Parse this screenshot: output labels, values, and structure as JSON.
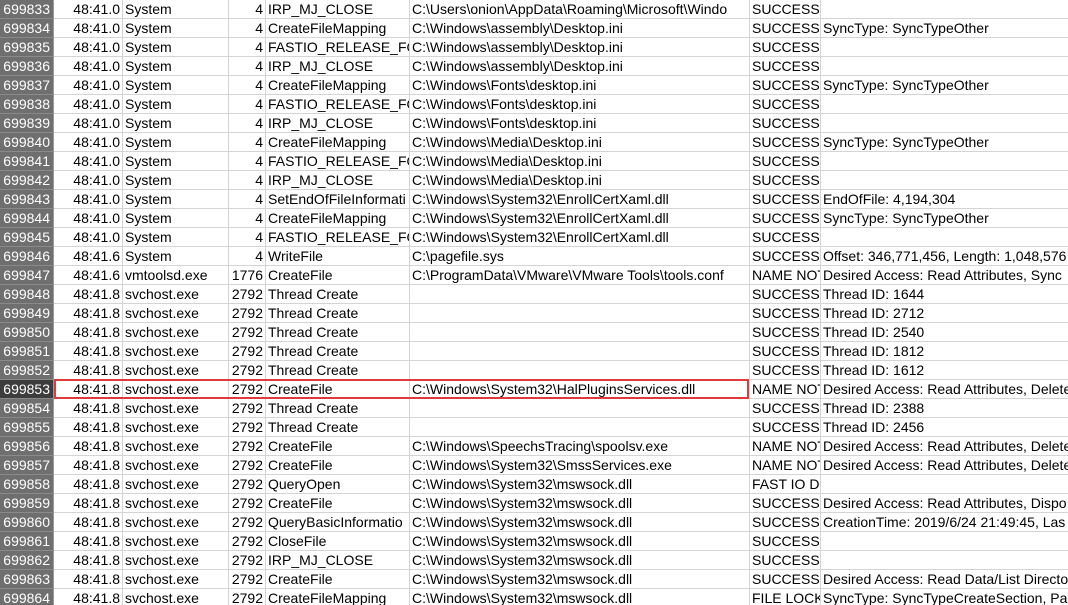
{
  "table": {
    "highlight_color": "#e23a3a",
    "rows": [
      {
        "id": "699833",
        "time": "48:41.0",
        "process": "System",
        "pid": "4",
        "operation": "IRP_MJ_CLOSE",
        "path": "C:\\Users\\onion\\AppData\\Roaming\\Microsoft\\Windo",
        "result": "SUCCESS",
        "detail": ""
      },
      {
        "id": "699834",
        "time": "48:41.0",
        "process": "System",
        "pid": "4",
        "operation": "CreateFileMapping",
        "path": "C:\\Windows\\assembly\\Desktop.ini",
        "result": "SUCCESS",
        "detail": "SyncType: SyncTypeOther"
      },
      {
        "id": "699835",
        "time": "48:41.0",
        "process": "System",
        "pid": "4",
        "operation": "FASTIO_RELEASE_FOR",
        "path": "C:\\Windows\\assembly\\Desktop.ini",
        "result": "SUCCESS",
        "detail": ""
      },
      {
        "id": "699836",
        "time": "48:41.0",
        "process": "System",
        "pid": "4",
        "operation": "IRP_MJ_CLOSE",
        "path": "C:\\Windows\\assembly\\Desktop.ini",
        "result": "SUCCESS",
        "detail": ""
      },
      {
        "id": "699837",
        "time": "48:41.0",
        "process": "System",
        "pid": "4",
        "operation": "CreateFileMapping",
        "path": "C:\\Windows\\Fonts\\desktop.ini",
        "result": "SUCCESS",
        "detail": "SyncType: SyncTypeOther"
      },
      {
        "id": "699838",
        "time": "48:41.0",
        "process": "System",
        "pid": "4",
        "operation": "FASTIO_RELEASE_FOR",
        "path": "C:\\Windows\\Fonts\\desktop.ini",
        "result": "SUCCESS",
        "detail": ""
      },
      {
        "id": "699839",
        "time": "48:41.0",
        "process": "System",
        "pid": "4",
        "operation": "IRP_MJ_CLOSE",
        "path": "C:\\Windows\\Fonts\\desktop.ini",
        "result": "SUCCESS",
        "detail": ""
      },
      {
        "id": "699840",
        "time": "48:41.0",
        "process": "System",
        "pid": "4",
        "operation": "CreateFileMapping",
        "path": "C:\\Windows\\Media\\Desktop.ini",
        "result": "SUCCESS",
        "detail": "SyncType: SyncTypeOther"
      },
      {
        "id": "699841",
        "time": "48:41.0",
        "process": "System",
        "pid": "4",
        "operation": "FASTIO_RELEASE_FOR",
        "path": "C:\\Windows\\Media\\Desktop.ini",
        "result": "SUCCESS",
        "detail": ""
      },
      {
        "id": "699842",
        "time": "48:41.0",
        "process": "System",
        "pid": "4",
        "operation": "IRP_MJ_CLOSE",
        "path": "C:\\Windows\\Media\\Desktop.ini",
        "result": "SUCCESS",
        "detail": ""
      },
      {
        "id": "699843",
        "time": "48:41.0",
        "process": "System",
        "pid": "4",
        "operation": "SetEndOfFileInformati",
        "path": "C:\\Windows\\System32\\EnrollCertXaml.dll",
        "result": "SUCCESS",
        "detail": "EndOfFile: 4,194,304"
      },
      {
        "id": "699844",
        "time": "48:41.0",
        "process": "System",
        "pid": "4",
        "operation": "CreateFileMapping",
        "path": "C:\\Windows\\System32\\EnrollCertXaml.dll",
        "result": "SUCCESS",
        "detail": "SyncType: SyncTypeOther"
      },
      {
        "id": "699845",
        "time": "48:41.0",
        "process": "System",
        "pid": "4",
        "operation": "FASTIO_RELEASE_FOR",
        "path": "C:\\Windows\\System32\\EnrollCertXaml.dll",
        "result": "SUCCESS",
        "detail": ""
      },
      {
        "id": "699846",
        "time": "48:41.6",
        "process": "System",
        "pid": "4",
        "operation": "WriteFile",
        "path": "C:\\pagefile.sys",
        "result": "SUCCESS",
        "detail": "Offset: 346,771,456, Length: 1,048,576"
      },
      {
        "id": "699847",
        "time": "48:41.6",
        "process": "vmtoolsd.exe",
        "pid": "1776",
        "operation": "CreateFile",
        "path": "C:\\ProgramData\\VMware\\VMware Tools\\tools.conf",
        "result": "NAME NOT",
        "detail": "Desired Access: Read Attributes, Sync"
      },
      {
        "id": "699848",
        "time": "48:41.8",
        "process": "svchost.exe",
        "pid": "2792",
        "operation": "Thread Create",
        "path": "",
        "result": "SUCCESS",
        "detail": "Thread ID: 1644"
      },
      {
        "id": "699849",
        "time": "48:41.8",
        "process": "svchost.exe",
        "pid": "2792",
        "operation": "Thread Create",
        "path": "",
        "result": "SUCCESS",
        "detail": "Thread ID: 2712"
      },
      {
        "id": "699850",
        "time": "48:41.8",
        "process": "svchost.exe",
        "pid": "2792",
        "operation": "Thread Create",
        "path": "",
        "result": "SUCCESS",
        "detail": "Thread ID: 2540"
      },
      {
        "id": "699851",
        "time": "48:41.8",
        "process": "svchost.exe",
        "pid": "2792",
        "operation": "Thread Create",
        "path": "",
        "result": "SUCCESS",
        "detail": "Thread ID: 1812"
      },
      {
        "id": "699852",
        "time": "48:41.8",
        "process": "svchost.exe",
        "pid": "2792",
        "operation": "Thread Create",
        "path": "",
        "result": "SUCCESS",
        "detail": "Thread ID: 1612"
      },
      {
        "id": "699853",
        "time": "48:41.8",
        "process": "svchost.exe",
        "pid": "2792",
        "operation": "CreateFile",
        "path": "C:\\Windows\\System32\\HalPluginsServices.dll",
        "result": "NAME NOT",
        "detail": "Desired Access: Read Attributes, Delete",
        "selected": true
      },
      {
        "id": "699854",
        "time": "48:41.8",
        "process": "svchost.exe",
        "pid": "2792",
        "operation": "Thread Create",
        "path": "",
        "result": "SUCCESS",
        "detail": "Thread ID: 2388"
      },
      {
        "id": "699855",
        "time": "48:41.8",
        "process": "svchost.exe",
        "pid": "2792",
        "operation": "Thread Create",
        "path": "",
        "result": "SUCCESS",
        "detail": "Thread ID: 2456"
      },
      {
        "id": "699856",
        "time": "48:41.8",
        "process": "svchost.exe",
        "pid": "2792",
        "operation": "CreateFile",
        "path": "C:\\Windows\\SpeechsTracing\\spoolsv.exe",
        "result": "NAME NOT",
        "detail": "Desired Access: Read Attributes, Delete"
      },
      {
        "id": "699857",
        "time": "48:41.8",
        "process": "svchost.exe",
        "pid": "2792",
        "operation": "CreateFile",
        "path": "C:\\Windows\\System32\\SmssServices.exe",
        "result": "NAME NOT",
        "detail": "Desired Access: Read Attributes, Delete"
      },
      {
        "id": "699858",
        "time": "48:41.8",
        "process": "svchost.exe",
        "pid": "2792",
        "operation": "QueryOpen",
        "path": "C:\\Windows\\System32\\mswsock.dll",
        "result": "FAST IO DISALLOWED",
        "detail": ""
      },
      {
        "id": "699859",
        "time": "48:41.8",
        "process": "svchost.exe",
        "pid": "2792",
        "operation": "CreateFile",
        "path": "C:\\Windows\\System32\\mswsock.dll",
        "result": "SUCCESS",
        "detail": "Desired Access: Read Attributes, Dispo"
      },
      {
        "id": "699860",
        "time": "48:41.8",
        "process": "svchost.exe",
        "pid": "2792",
        "operation": "QueryBasicInformatio",
        "path": "C:\\Windows\\System32\\mswsock.dll",
        "result": "SUCCESS",
        "detail": "CreationTime: 2019/6/24 21:49:45, Las"
      },
      {
        "id": "699861",
        "time": "48:41.8",
        "process": "svchost.exe",
        "pid": "2792",
        "operation": "CloseFile",
        "path": "C:\\Windows\\System32\\mswsock.dll",
        "result": "SUCCESS",
        "detail": ""
      },
      {
        "id": "699862",
        "time": "48:41.8",
        "process": "svchost.exe",
        "pid": "2792",
        "operation": "IRP_MJ_CLOSE",
        "path": "C:\\Windows\\System32\\mswsock.dll",
        "result": "SUCCESS",
        "detail": ""
      },
      {
        "id": "699863",
        "time": "48:41.8",
        "process": "svchost.exe",
        "pid": "2792",
        "operation": "CreateFile",
        "path": "C:\\Windows\\System32\\mswsock.dll",
        "result": "SUCCESS",
        "detail": "Desired Access: Read Data/List Directo"
      },
      {
        "id": "699864",
        "time": "48:41.8",
        "process": "svchost.exe",
        "pid": "2792",
        "operation": "CreateFileMapping",
        "path": "C:\\Windows\\System32\\mswsock.dll",
        "result": "FILE LOCKED",
        "detail": "SyncType: SyncTypeCreateSection, Pa"
      }
    ]
  }
}
